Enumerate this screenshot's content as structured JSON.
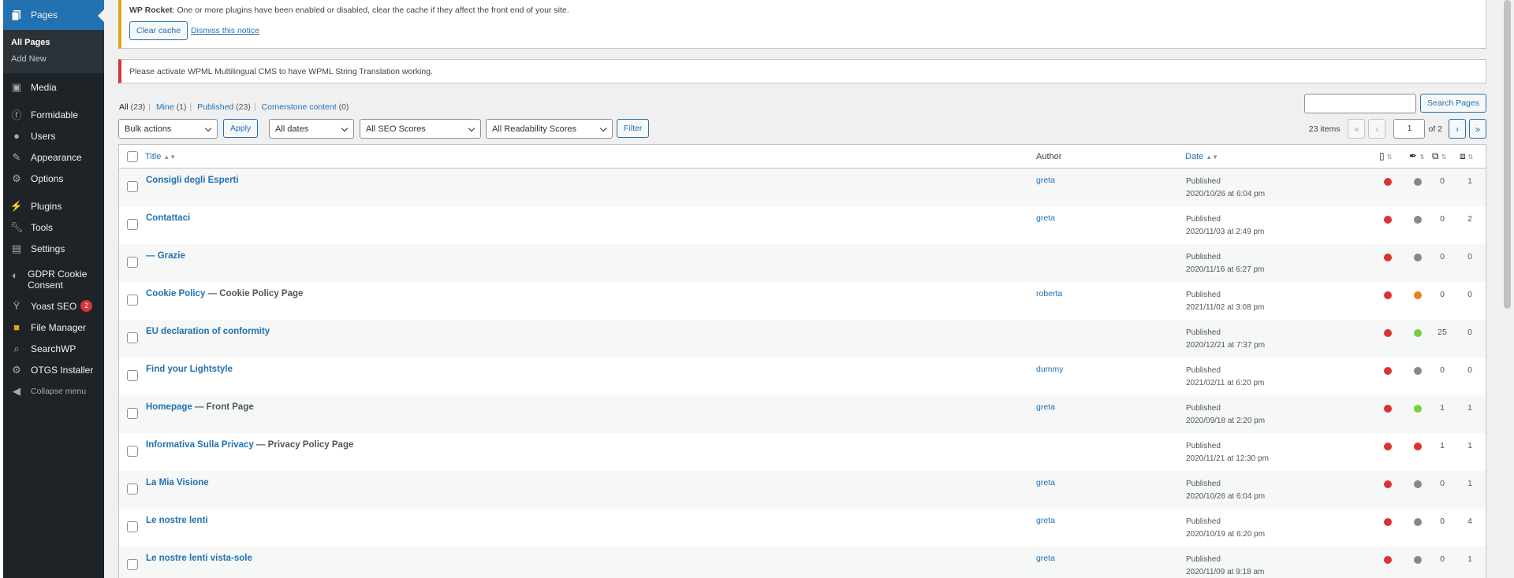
{
  "sidebar": {
    "current": "Pages",
    "submenu": [
      "All Pages",
      "Add New"
    ],
    "items": [
      {
        "label": "Media",
        "icon": "media-icon"
      },
      {
        "label": "Formidable",
        "icon": "formidable-icon"
      },
      {
        "label": "Users",
        "icon": "users-icon"
      },
      {
        "label": "Appearance",
        "icon": "appearance-icon"
      },
      {
        "label": "Options",
        "icon": "gear-icon"
      },
      {
        "label": "Plugins",
        "icon": "plugins-icon"
      },
      {
        "label": "Tools",
        "icon": "wrench-icon"
      },
      {
        "label": "Settings",
        "icon": "settings-icon"
      },
      {
        "label": "GDPR Cookie Consent",
        "icon": "cookie-icon"
      },
      {
        "label": "Yoast SEO",
        "icon": "yoast-icon",
        "badge": "2"
      },
      {
        "label": "File Manager",
        "icon": "folder-icon"
      },
      {
        "label": "SearchWP",
        "icon": "searchwp-icon"
      },
      {
        "label": "OTGS Installer",
        "icon": "gear-icon"
      },
      {
        "label": "Collapse menu",
        "icon": "collapse-icon"
      }
    ]
  },
  "notices": {
    "rocket_brand": "WP Rocket",
    "rocket_text": ": One or more plugins have been enabled or disabled, clear the cache if they affect the front end of your site.",
    "clear_cache": "Clear cache",
    "dismiss": "Dismiss this notice",
    "wpml": "Please activate WPML Multilingual CMS to have WPML String Translation working."
  },
  "views": {
    "all": "All",
    "all_count": "(23)",
    "mine": "Mine",
    "mine_count": "(1)",
    "published": "Published",
    "published_count": "(23)",
    "cornerstone": "Cornerstone content",
    "cornerstone_count": "(0)"
  },
  "search": {
    "button": "Search Pages",
    "value": ""
  },
  "filters": {
    "bulk": "Bulk actions",
    "apply": "Apply",
    "dates": "All dates",
    "seo": "All SEO Scores",
    "readability": "All Readability Scores",
    "filter": "Filter"
  },
  "pagination": {
    "items": "23 items",
    "first": "«",
    "prev": "‹",
    "page": "1",
    "of": "of 2",
    "next": "›",
    "last": "»"
  },
  "columns": {
    "title": "Title",
    "author": "Author",
    "date": "Date"
  },
  "colors": {
    "red": "#dc3232",
    "gray": "#888888",
    "orange": "#ee7c1b",
    "green": "#7ad03a",
    "link": "#2271b1"
  },
  "rows": [
    {
      "title": "Consigli degli Esperti",
      "state": "",
      "author": "greta",
      "status": "Published",
      "date": "2020/10/26 at 6:04 pm",
      "seo": "red",
      "read": "gray",
      "links_out": "0",
      "links_in": "1"
    },
    {
      "title": "Contattaci",
      "state": "",
      "author": "greta",
      "status": "Published",
      "date": "2020/11/03 at 2:49 pm",
      "seo": "red",
      "read": "gray",
      "links_out": "0",
      "links_in": "2"
    },
    {
      "title": "— Grazie",
      "state": "",
      "author": "",
      "status": "Published",
      "date": "2020/11/16 at 6:27 pm",
      "seo": "red",
      "read": "gray",
      "links_out": "0",
      "links_in": "0"
    },
    {
      "title": "Cookie Policy",
      "state": " — Cookie Policy Page",
      "author": "roberta",
      "status": "Published",
      "date": "2021/11/02 at 3:08 pm",
      "seo": "red",
      "read": "orange",
      "links_out": "0",
      "links_in": "0"
    },
    {
      "title": "EU declaration of conformity",
      "state": "",
      "author": "",
      "status": "Published",
      "date": "2020/12/21 at 7:37 pm",
      "seo": "red",
      "read": "green",
      "links_out": "25",
      "links_in": "0"
    },
    {
      "title": "Find your Lightstyle",
      "state": "",
      "author": "dummy",
      "status": "Published",
      "date": "2021/02/11 at 6:20 pm",
      "seo": "red",
      "read": "gray",
      "links_out": "0",
      "links_in": "0"
    },
    {
      "title": "Homepage",
      "state": " — Front Page",
      "author": "greta",
      "status": "Published",
      "date": "2020/09/18 at 2:20 pm",
      "seo": "red",
      "read": "green",
      "links_out": "1",
      "links_in": "1"
    },
    {
      "title": "Informativa Sulla Privacy",
      "state": " — Privacy Policy Page",
      "author": "",
      "status": "Published",
      "date": "2020/11/21 at 12:30 pm",
      "seo": "red",
      "read": "red",
      "links_out": "1",
      "links_in": "1"
    },
    {
      "title": "La Mia Visione",
      "state": "",
      "author": "greta",
      "status": "Published",
      "date": "2020/10/26 at 6:04 pm",
      "seo": "red",
      "read": "gray",
      "links_out": "0",
      "links_in": "1"
    },
    {
      "title": "Le nostre lenti",
      "state": "",
      "author": "greta",
      "status": "Published",
      "date": "2020/10/19 at 6:20 pm",
      "seo": "red",
      "read": "gray",
      "links_out": "0",
      "links_in": "4"
    },
    {
      "title": "Le nostre lenti vista-sole",
      "state": "",
      "author": "greta",
      "status": "Published",
      "date": "2020/11/09 at 9:18 am",
      "seo": "red",
      "read": "gray",
      "links_out": "0",
      "links_in": "1"
    }
  ]
}
